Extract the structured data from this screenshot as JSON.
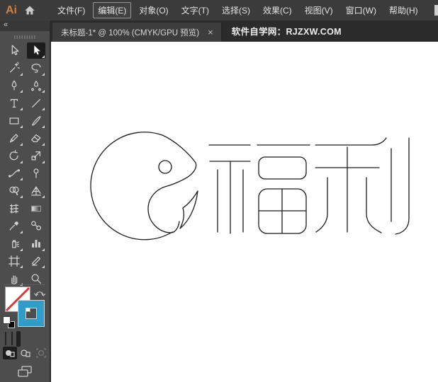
{
  "menubar": {
    "logo": "Ai",
    "items": [
      {
        "key": "F",
        "label": "文件(F)"
      },
      {
        "key": "E",
        "label": "编辑(E)",
        "active": true
      },
      {
        "key": "O",
        "label": "对象(O)"
      },
      {
        "key": "T",
        "label": "文字(T)"
      },
      {
        "key": "S",
        "label": "选择(S)"
      },
      {
        "key": "C",
        "label": "效果(C)"
      },
      {
        "key": "V",
        "label": "视图(V)"
      },
      {
        "key": "W",
        "label": "窗口(W)"
      },
      {
        "key": "H",
        "label": "帮助(H)"
      }
    ]
  },
  "tabbar": {
    "document_tab": {
      "title": "未标题-1* @ 100% (CMYK/GPU 预览)",
      "close_glyph": "×"
    },
    "site_label": "软件自学网：RJZXW.COM"
  },
  "toolbar": {
    "collapse_glyph": "«",
    "tools": [
      {
        "name": "selection",
        "flyout": false
      },
      {
        "name": "direct-selection",
        "selected": true,
        "flyout": true
      },
      {
        "name": "magic-wand",
        "flyout": true
      },
      {
        "name": "lasso",
        "flyout": true
      },
      {
        "name": "pen",
        "flyout": true
      },
      {
        "name": "curvature",
        "flyout": true
      },
      {
        "name": "type",
        "flyout": true
      },
      {
        "name": "line-segment",
        "flyout": true
      },
      {
        "name": "rectangle",
        "flyout": true
      },
      {
        "name": "paintbrush",
        "flyout": true
      },
      {
        "name": "pencil",
        "flyout": true
      },
      {
        "name": "eraser",
        "flyout": true
      },
      {
        "name": "rotate",
        "flyout": true
      },
      {
        "name": "scale",
        "flyout": true
      },
      {
        "name": "width",
        "flyout": true
      },
      {
        "name": "puppet-warp",
        "flyout": false
      },
      {
        "name": "shape-builder",
        "flyout": true
      },
      {
        "name": "perspective-grid",
        "flyout": true
      },
      {
        "name": "mesh",
        "flyout": false
      },
      {
        "name": "gradient",
        "flyout": false
      },
      {
        "name": "eyedropper",
        "flyout": true
      },
      {
        "name": "blend",
        "flyout": false
      },
      {
        "name": "symbol-sprayer",
        "flyout": true
      },
      {
        "name": "column-graph",
        "flyout": true
      },
      {
        "name": "artboard",
        "flyout": true
      },
      {
        "name": "slice",
        "flyout": true
      },
      {
        "name": "hand",
        "flyout": true
      },
      {
        "name": "zoom",
        "flyout": false
      }
    ]
  },
  "colors": {
    "accent_blue": "#2F9DC9",
    "none_red": "#D93A3A",
    "artwork_stroke": "#1C1C1C"
  },
  "artwork": {
    "characters": "福利",
    "logo": "fish"
  }
}
